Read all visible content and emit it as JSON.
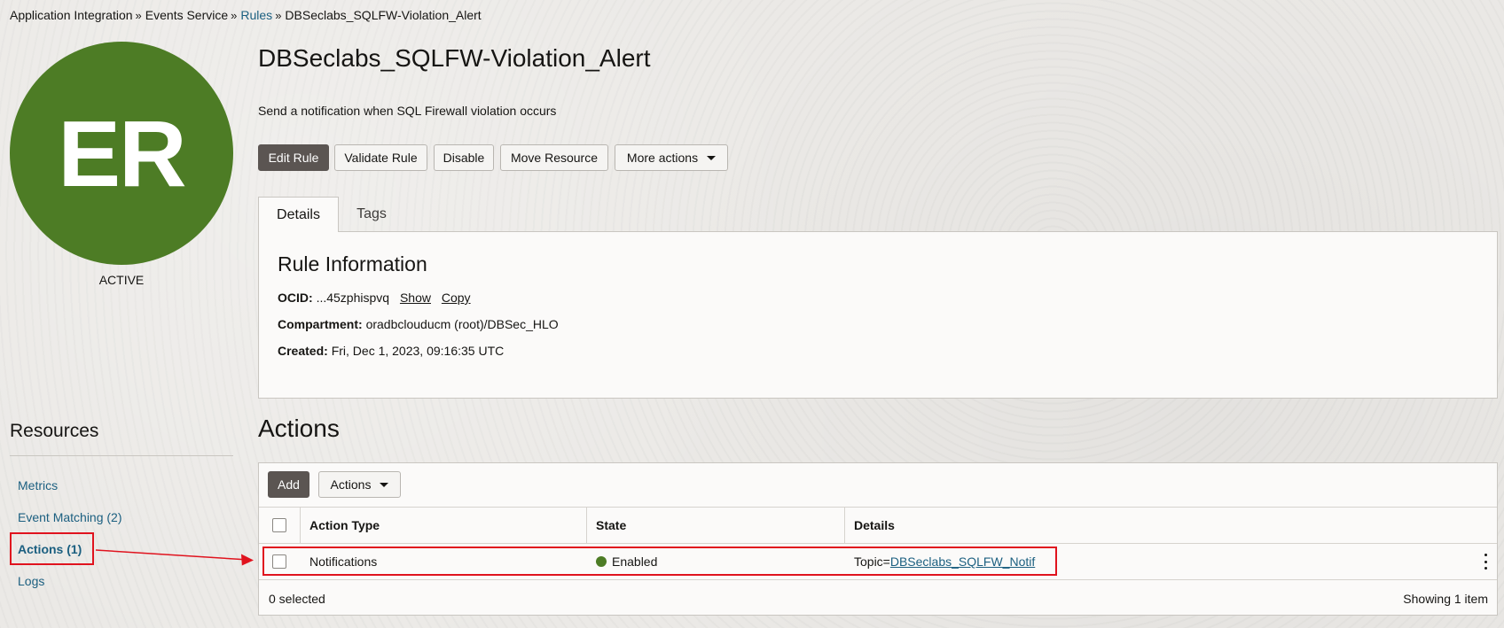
{
  "breadcrumb": {
    "items": [
      "Application Integration",
      "Events Service",
      "Rules",
      "DBSeclabs_SQLFW-Violation_Alert"
    ],
    "separator": "»"
  },
  "avatar": {
    "initials": "ER",
    "color": "#4d7c25",
    "status": "ACTIVE"
  },
  "resources": {
    "title": "Resources",
    "items": [
      "Metrics",
      "Event Matching (2)",
      "Actions (1)",
      "Logs"
    ],
    "active_index": 2
  },
  "rule": {
    "title": "DBSeclabs_SQLFW-Violation_Alert",
    "description": "Send a notification when SQL Firewall violation occurs"
  },
  "toolbar": {
    "edit_rule": "Edit Rule",
    "validate_rule": "Validate Rule",
    "disable": "Disable",
    "move_resource": "Move Resource",
    "more_actions": "More actions"
  },
  "tabs": [
    "Details",
    "Tags"
  ],
  "rule_info": {
    "title": "Rule Information",
    "ocid_label": "OCID:",
    "ocid_value": "...45zphispvq",
    "show_link": "Show",
    "copy_link": "Copy",
    "compartment_label": "Compartment:",
    "compartment_value": "oradbclouducm (root)/DBSec_HLO",
    "created_label": "Created:",
    "created_value": "Fri, Dec 1, 2023, 09:16:35 UTC"
  },
  "actions_section": {
    "title": "Actions",
    "add_button": "Add",
    "actions_dropdown": "Actions",
    "columns": [
      "Action Type",
      "State",
      "Details"
    ],
    "rows": [
      {
        "action_type": "Notifications",
        "state": "Enabled",
        "details_prefix": "Topic=",
        "details_link": "DBSeclabs_SQLFW_Notif"
      }
    ],
    "selected_text": "0 selected",
    "showing_text": "Showing 1 item"
  },
  "colors": {
    "accent_link": "#1b5f80",
    "primary_button": "#5b5552",
    "status_green": "#4d7c25",
    "annotation_red": "#e0131e"
  }
}
